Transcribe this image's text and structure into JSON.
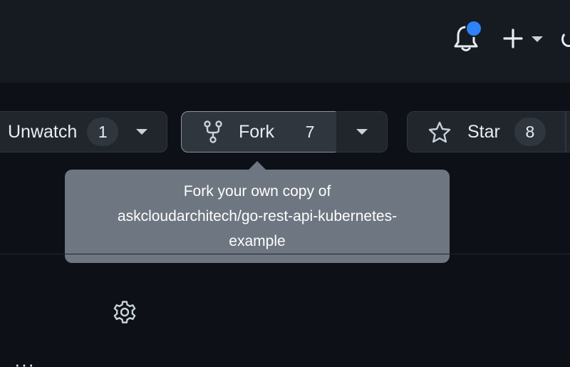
{
  "header": {
    "notification_icon": "bell-icon",
    "notification_indicator_color": "#2f81f7",
    "create_icon": "plus-icon",
    "create_dropdown_icon": "caret-down-icon"
  },
  "repo_actions": {
    "watch": {
      "label": "Unwatch",
      "count": "1",
      "icon": "eye-icon"
    },
    "fork": {
      "label": "Fork",
      "count": "7",
      "icon": "repo-forked-icon"
    },
    "star": {
      "label": "Star",
      "count": "8",
      "icon": "star-icon"
    }
  },
  "tooltip": {
    "line1": "Fork your own copy of",
    "line2": "askcloudarchitech/go-rest-api-kubernetes-",
    "line3": "example"
  },
  "content": {
    "settings_icon": "gear-icon",
    "partial_text": "··· "
  },
  "colors": {
    "background": "#0d1117",
    "header_bg": "#161b22",
    "button_bg": "#21262d",
    "tooltip_bg": "#6e7681",
    "accent_blue": "#2f81f7"
  }
}
